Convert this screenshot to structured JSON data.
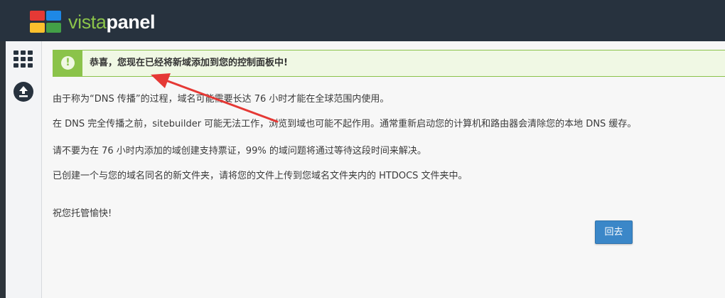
{
  "header": {
    "logo_text_light": "vista",
    "logo_text_bold": "panel",
    "logo_colors": [
      "#e53935",
      "#1e88e5",
      "#fbc02d",
      "#43a047"
    ]
  },
  "sidebar": {
    "items": [
      {
        "icon": "grid-icon"
      },
      {
        "icon": "upload-icon"
      }
    ]
  },
  "alert": {
    "icon": "exclamation-icon",
    "text": "恭喜，您现在已经将新域添加到您的控制面板中!"
  },
  "content": {
    "paragraphs": [
      "由于称为“DNS 传播”的过程，域名可能需要长达 76 小时才能在全球范围内使用。",
      "在 DNS 完全传播之前，sitebuilder 可能无法工作，浏览到域也可能不起作用。通常重新启动您的计算机和路由器会清除您的本地 DNS 缓存。",
      "请不要为在 76 小时内添加的域创建支持票证，99% 的域问题将通过等待这段时间来解决。",
      "已创建一个与您的域名同名的新文件夹，请将您的文件上传到您域名文件夹内的 HTDOCS 文件夹中。"
    ],
    "closing": "祝您托管愉快!"
  },
  "actions": {
    "back_label": "回去"
  },
  "colors": {
    "header_bg": "#27323e",
    "accent_green": "#8bc34a",
    "button_blue": "#3b87c8",
    "annotation_red": "#e53935"
  }
}
